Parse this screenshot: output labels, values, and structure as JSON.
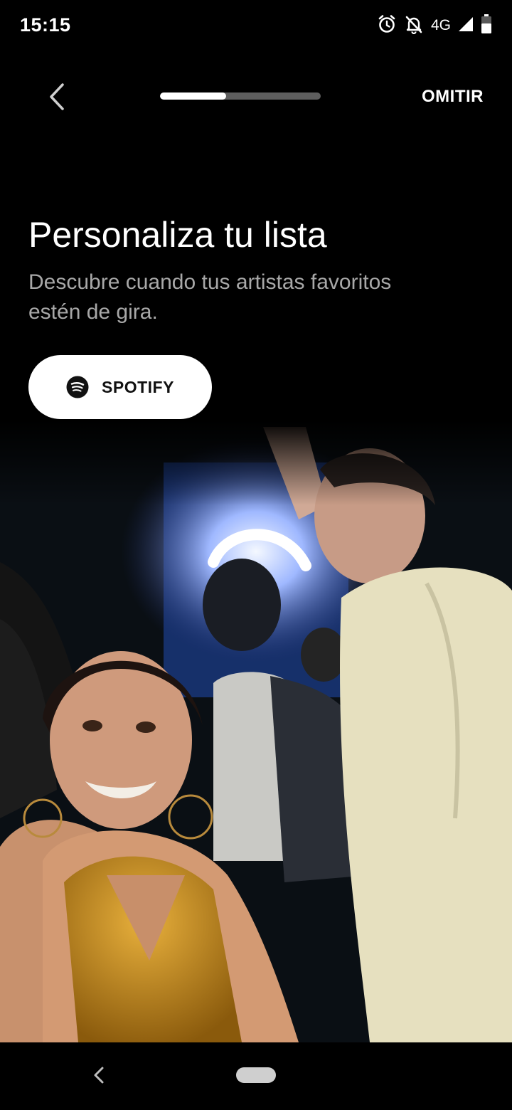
{
  "status_bar": {
    "time": "15:15",
    "network": "4G",
    "icons": [
      "alarm-icon",
      "notifications-off-icon",
      "signal-icon",
      "battery-icon"
    ]
  },
  "onboarding": {
    "back_icon": "chevron-left-icon",
    "progress_fraction": 0.41,
    "skip_label": "OMITIR",
    "title": "Personaliza tu lista",
    "subtitle": "Descubre cuando tus artistas favoritos estén de gira.",
    "connect_button": {
      "label": "SPOTIFY",
      "icon": "spotify-icon"
    },
    "hero_image": "photo-concert-crowd"
  },
  "colors": {
    "background": "#000000",
    "subtitle": "#a8a8a8",
    "progress_track": "#5e5e5e",
    "button_bg": "#ffffff"
  },
  "nav_bar": {
    "back_icon": "nav-back-icon",
    "home_icon": "home-pill-icon"
  }
}
